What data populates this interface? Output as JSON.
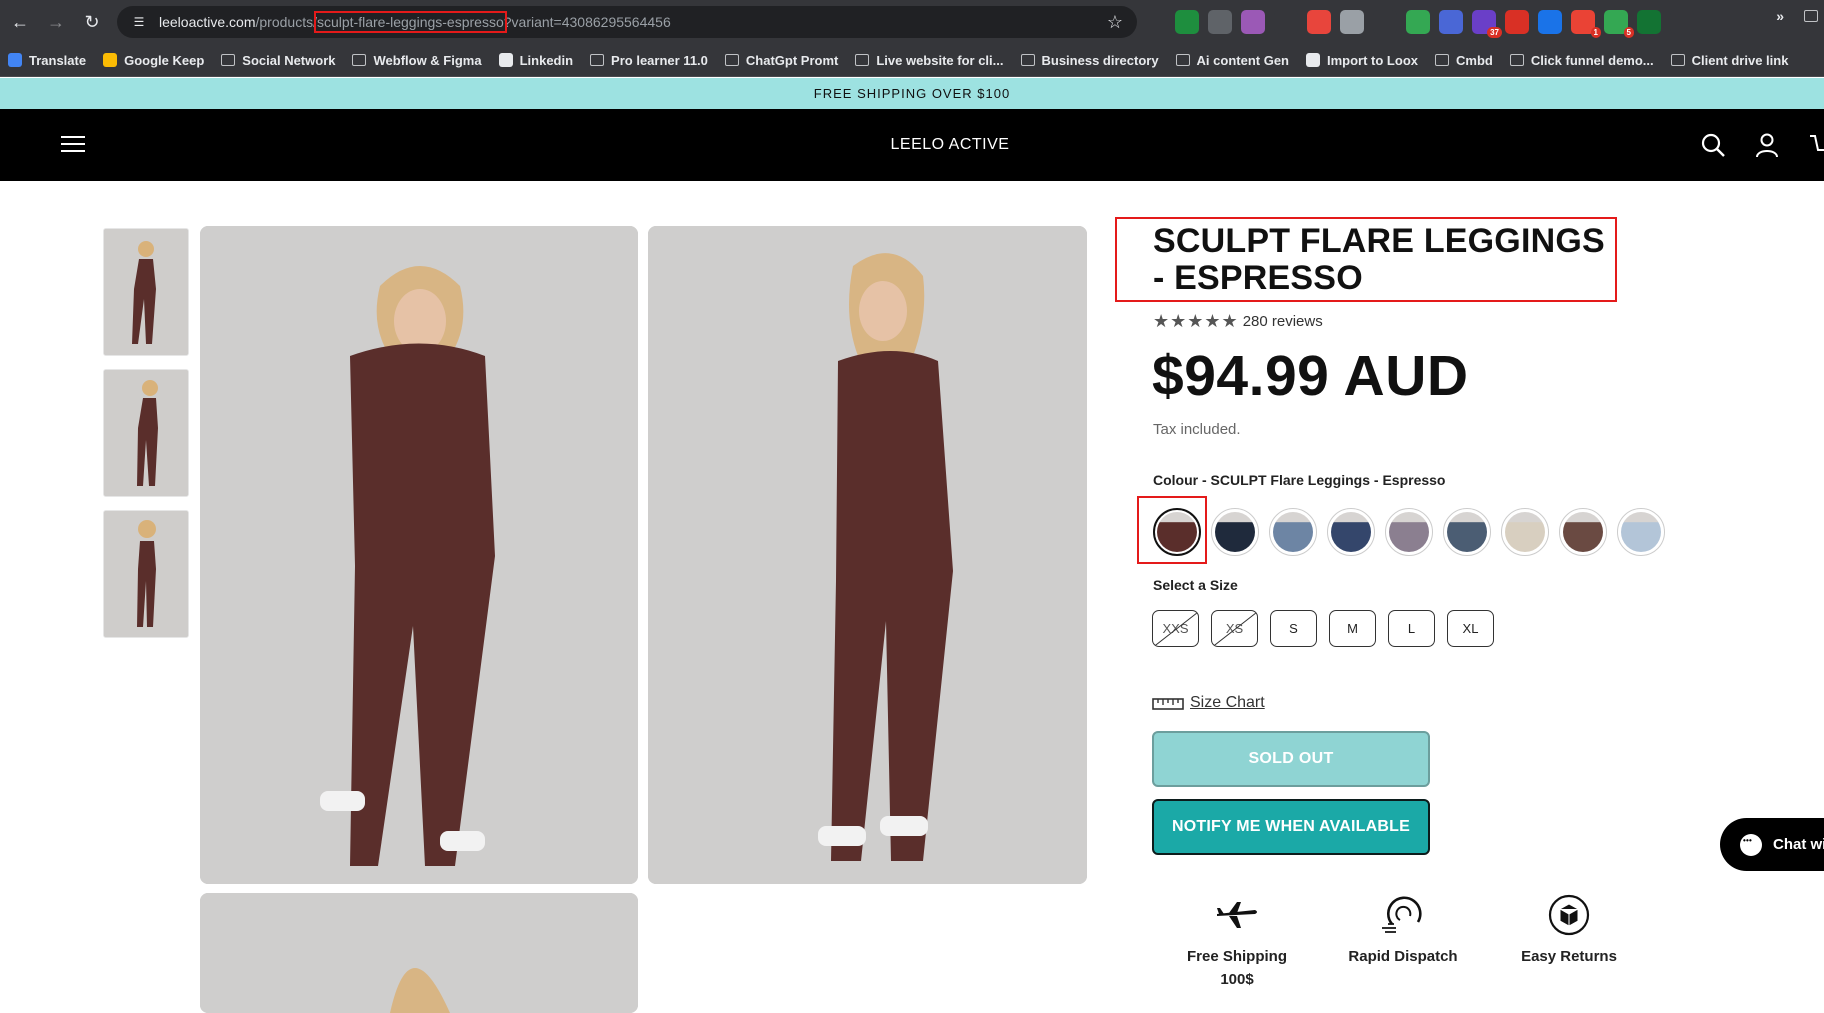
{
  "browser": {
    "url_host": "leeloactive.com",
    "url_path_prefix": "/products/",
    "url_slug": "sculpt-flare-leggings-espresso",
    "url_query": "?variant=43086295564456",
    "extensions": [
      {
        "name": "green-ext-icon",
        "color": "#1e8e3e",
        "badge": ""
      },
      {
        "name": "camera-ext-icon",
        "color": "#5f6368",
        "badge": ""
      },
      {
        "name": "pen-ext-icon",
        "color": "#9b59b6",
        "badge": ""
      },
      {
        "name": "font-ext-icon",
        "color": "#35363a",
        "badge": ""
      },
      {
        "name": "red-tool-ext-icon",
        "color": "#e8453c",
        "badge": ""
      },
      {
        "name": "grey-ext-icon",
        "color": "#9aa0a6",
        "badge": ""
      },
      {
        "name": "wordpress-ext-icon",
        "color": "#35363a",
        "badge": ""
      },
      {
        "name": "cart-ext-icon",
        "color": "#34a853",
        "badge": ""
      },
      {
        "name": "gear-ext-icon",
        "color": "#4a67d6",
        "badge": ""
      },
      {
        "name": "purple-ext-icon",
        "color": "#6a3fc8",
        "badge": "37"
      },
      {
        "name": "red-shield-ext-icon",
        "color": "#d93025",
        "badge": ""
      },
      {
        "name": "download-ext-icon",
        "color": "#1a73e8",
        "badge": ""
      },
      {
        "name": "notify-ext-icon",
        "color": "#ea4335",
        "badge": "1"
      },
      {
        "name": "stack-ext-icon",
        "color": "#34a853",
        "badge": "5"
      },
      {
        "name": "teal-ext-icon",
        "color": "#137333",
        "badge": ""
      },
      {
        "name": "puzzle-ext-icon",
        "color": "#35363a",
        "badge": ""
      }
    ],
    "bookmarks": [
      {
        "label": "Translate",
        "type": "app",
        "color": "#4285f4"
      },
      {
        "label": "Google Keep",
        "type": "app",
        "color": "#fbbc04"
      },
      {
        "label": "Social Network",
        "type": "folder"
      },
      {
        "label": "Webflow & Figma",
        "type": "folder"
      },
      {
        "label": "Linkedin",
        "type": "app",
        "color": "#e8eaed"
      },
      {
        "label": "Pro learner 11.0",
        "type": "folder"
      },
      {
        "label": "ChatGpt Promt",
        "type": "folder"
      },
      {
        "label": "Live website for cli...",
        "type": "folder"
      },
      {
        "label": "Business directory",
        "type": "folder"
      },
      {
        "label": "Ai content Gen",
        "type": "folder"
      },
      {
        "label": "Import to Loox",
        "type": "app",
        "color": "#e8eaed"
      },
      {
        "label": "Cmbd",
        "type": "folder"
      },
      {
        "label": "Click funnel demo...",
        "type": "folder"
      },
      {
        "label": "Client drive link",
        "type": "folder"
      }
    ],
    "more_label": "»"
  },
  "site": {
    "announcement": "FREE SHIPPING OVER $100",
    "brand": "LEELO ACTIVE"
  },
  "product": {
    "title": "SCULPT FLARE LEGGINGS - ESPRESSO",
    "stars": "★★★★★",
    "reviews": "280 reviews",
    "price": "$94.99 AUD",
    "tax_note": "Tax included.",
    "colour_label": "Colour - SCULPT Flare Leggings - Espresso",
    "swatch_colors": [
      "#5a2e2b",
      "#1f2a3c",
      "#6d85a4",
      "#34466b",
      "#8b7f90",
      "#4b5d73",
      "#d8cfc0",
      "#6a4a42",
      "#b3c5d8"
    ],
    "size_label": "Select a Size",
    "sizes": [
      {
        "label": "XXS",
        "available": false
      },
      {
        "label": "XS",
        "available": false
      },
      {
        "label": "S",
        "available": true
      },
      {
        "label": "M",
        "available": true
      },
      {
        "label": "L",
        "available": true
      },
      {
        "label": "XL",
        "available": true
      }
    ],
    "size_chart_label": "Size Chart",
    "sold_out_label": "SOLD OUT",
    "notify_label": "NOTIFY ME WHEN AVAILABLE",
    "perks": [
      {
        "label": "Free Shipping",
        "sub": "100$",
        "icon": "airplane-icon"
      },
      {
        "label": "Rapid Dispatch",
        "sub": "",
        "icon": "speed-dial-icon"
      },
      {
        "label": "Easy Returns",
        "sub": "",
        "icon": "box-icon"
      }
    ]
  },
  "chat": {
    "label": "Chat wi"
  },
  "colors": {
    "announcement_bg": "#9de2e1",
    "header_bg": "#000000",
    "sold_out_bg": "#8fd4d3",
    "notify_bg": "#1ba9a7",
    "highlight": "#e41a1a",
    "leggings": "#5a2e2b"
  }
}
